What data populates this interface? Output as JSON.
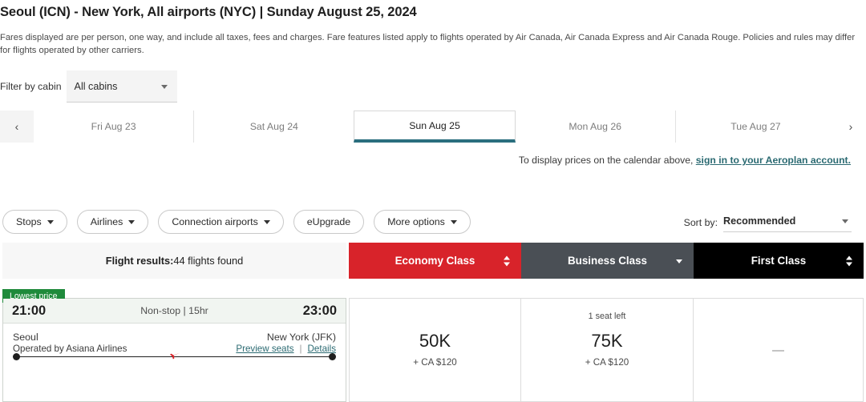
{
  "header": {
    "route_title": "Seoul (ICN) - New York, All airports (NYC)  |  Sunday August 25, 2024",
    "fare_note": "Fares displayed are per person, one way, and include all taxes, fees and charges. Fare features listed apply to flights operated by Air Canada, Air Canada Express and Air Canada Rouge. Policies and rules may differ for flights operated by other carriers."
  },
  "cabin_filter": {
    "label": "Filter by cabin",
    "selected": "All cabins",
    "caret_icon": "chevron-down-icon"
  },
  "date_carousel": {
    "prev_icon": "chevron-left-icon",
    "next_icon": "chevron-right-icon",
    "prev_label": "‹",
    "next_label": "›",
    "active_color": "#2a6e7e",
    "tabs": [
      {
        "label": "Fri Aug 23",
        "active": false
      },
      {
        "label": "Sat Aug 24",
        "active": false
      },
      {
        "label": "Sun Aug 25",
        "active": true
      },
      {
        "label": "Mon Aug 26",
        "active": false
      },
      {
        "label": "Tue Aug 27",
        "active": false
      }
    ]
  },
  "aeroplan_note": {
    "text": "To display prices on the calendar above, ",
    "link_text": "sign in to your Aeroplan account."
  },
  "filters": [
    {
      "label": "Stops",
      "has_caret": true
    },
    {
      "label": "Airlines",
      "has_caret": true
    },
    {
      "label": "Connection airports",
      "has_caret": true
    },
    {
      "label": "eUpgrade",
      "has_caret": false
    },
    {
      "label": "More options",
      "has_caret": true
    }
  ],
  "sort": {
    "label": "Sort by:",
    "selected": "Recommended",
    "caret_icon": "chevron-down-icon"
  },
  "results_header": {
    "results_label": "Flight results:",
    "results_count": "44 flights found",
    "classes": [
      {
        "label": "Economy Class",
        "color": "#d8232a",
        "sort_control": "up-down-arrows-icon"
      },
      {
        "label": "Business Class",
        "color": "#4a4f55",
        "sort_control": "chevron-down-icon"
      },
      {
        "label": "First Class",
        "color": "#000000",
        "sort_control": "up-down-arrows-icon"
      }
    ]
  },
  "flight": {
    "badge": "Lowest price",
    "badge_color": "#1f8a3b",
    "depart_time": "21:00",
    "arrive_time": "23:00",
    "duration_text": "Non-stop | 15hr",
    "origin_city": "Seoul",
    "destination_city": "New York (JFK)",
    "operated_by": "Operated by Asiana Airlines",
    "preview_seats_label": "Preview seats",
    "link_separator": "|",
    "details_label": "Details",
    "plane_icon": "airplane-icon",
    "plane_glyph": "✈",
    "prices": {
      "economy": {
        "amount": "50K",
        "taxes": "+ CA $120",
        "seat_note": ""
      },
      "business": {
        "amount": "75K",
        "taxes": "+ CA $120",
        "seat_note": "1 seat left"
      },
      "first": {
        "amount": "—",
        "taxes": "",
        "seat_note": ""
      }
    }
  }
}
